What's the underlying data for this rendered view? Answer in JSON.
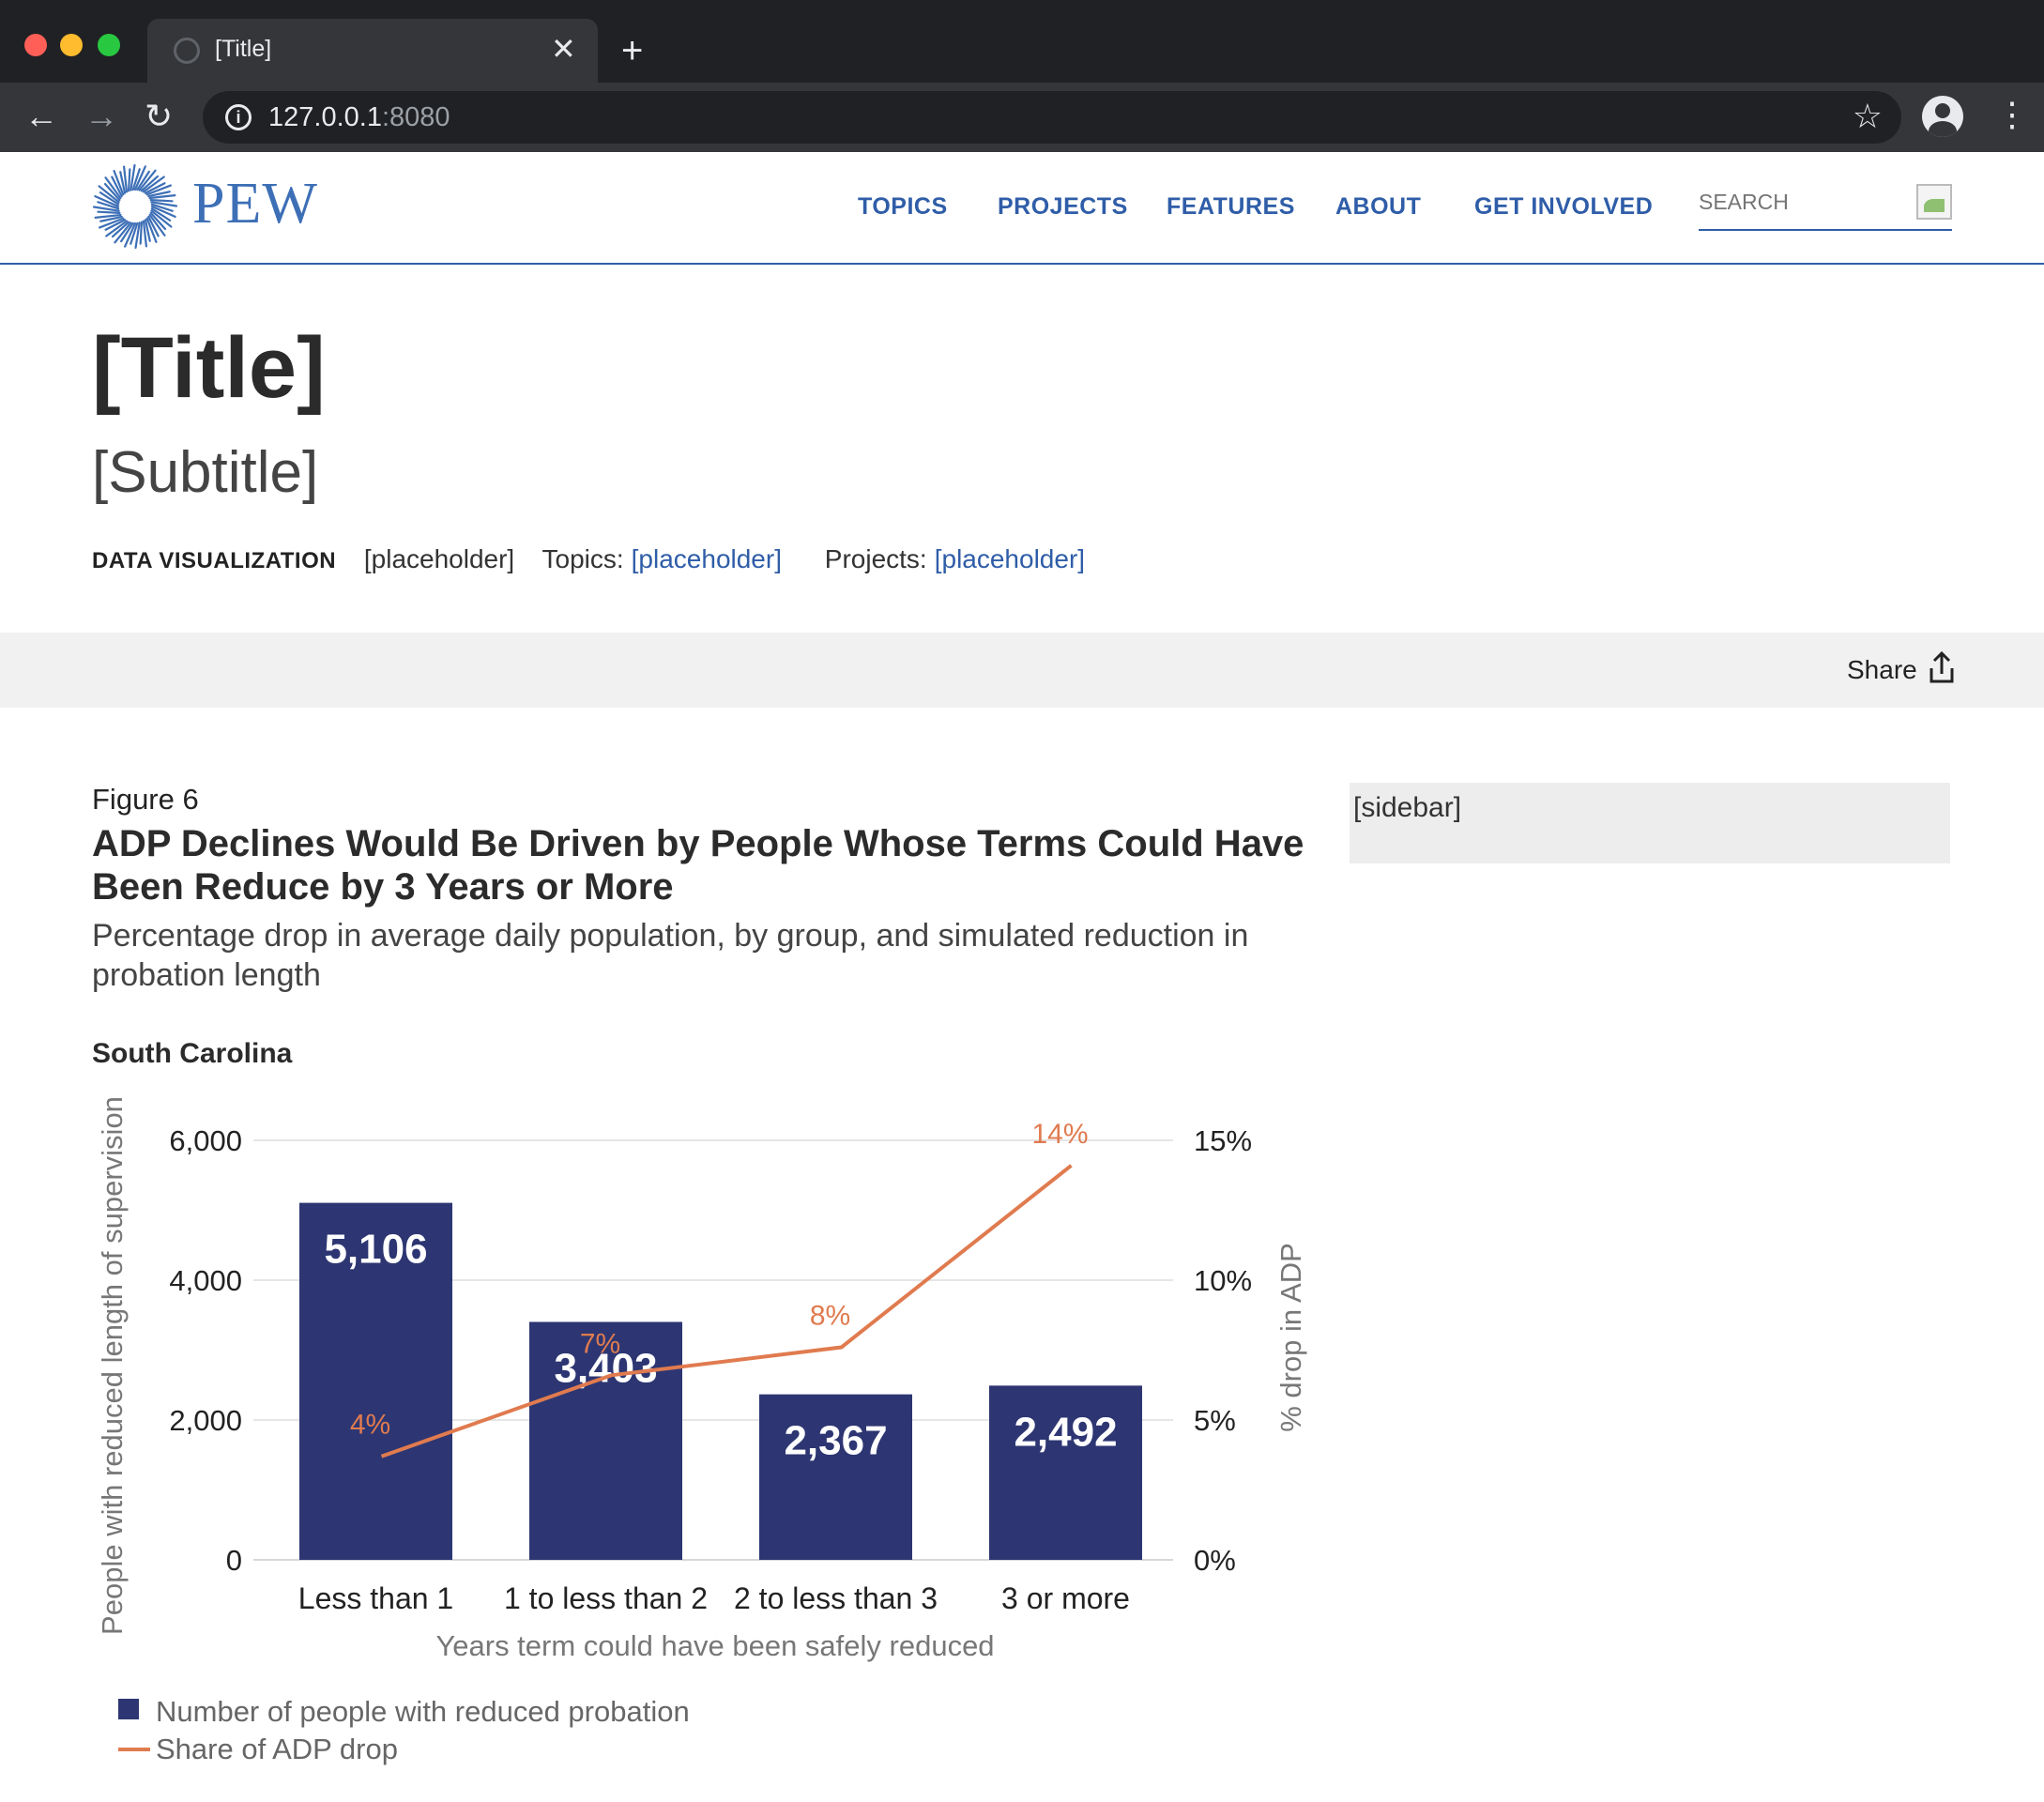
{
  "browser": {
    "tab_title": "[Title]",
    "url_host": "127.0.0.1",
    "url_port": ":8080"
  },
  "site": {
    "logo_text": "PEW",
    "nav": [
      "TOPICS",
      "PROJECTS",
      "FEATURES",
      "ABOUT",
      "GET INVOLVED"
    ],
    "search_placeholder": "SEARCH"
  },
  "page": {
    "title": "[Title]",
    "subtitle": "[Subtitle]",
    "meta": {
      "kind": "DATA VISUALIZATION",
      "date": "[placeholder]",
      "topics_label": "Topics:",
      "topics_value": "[placeholder]",
      "projects_label": "Projects:",
      "projects_value": "[placeholder]"
    },
    "share_label": "Share",
    "sidebar_text": "[sidebar]"
  },
  "figure": {
    "label": "Figure 6",
    "title": "ADP Declines Would Be Driven by People Whose Terms Could Have Been Reduce by 3 Years or More",
    "subtitle": "Percentage drop in average daily population, by group, and simulated reduction in probation length",
    "region": "South Carolina"
  },
  "chart_data": {
    "type": "bar",
    "categories": [
      "Less than 1",
      "1 to less than 2",
      "2 to less than 3",
      "3 or more"
    ],
    "series": [
      {
        "name": "Number of people with reduced probation",
        "type": "bar",
        "axis": "left",
        "values": [
          5106,
          3403,
          2367,
          2492
        ],
        "labels": [
          "5,106",
          "3,403",
          "2,367",
          "2,492"
        ],
        "color": "#2d3672"
      },
      {
        "name": "Share of ADP drop",
        "type": "line",
        "axis": "right",
        "values": [
          3.7,
          6.6,
          7.6,
          14.1
        ],
        "labels": [
          "4%",
          "7%",
          "8%",
          "14%"
        ],
        "color": "#e07b4f"
      }
    ],
    "xlabel": "Years term could have been safely reduced",
    "ylabel": "People with reduced length of supervision",
    "y2label": "% drop in ADP",
    "ylim": [
      0,
      6000
    ],
    "y2lim": [
      0,
      15
    ],
    "yticks": [
      "0",
      "2,000",
      "4,000",
      "6,000"
    ],
    "y2ticks": [
      "0%",
      "5%",
      "10%",
      "15%"
    ],
    "grid": true,
    "legend_position": "bottom-left"
  }
}
